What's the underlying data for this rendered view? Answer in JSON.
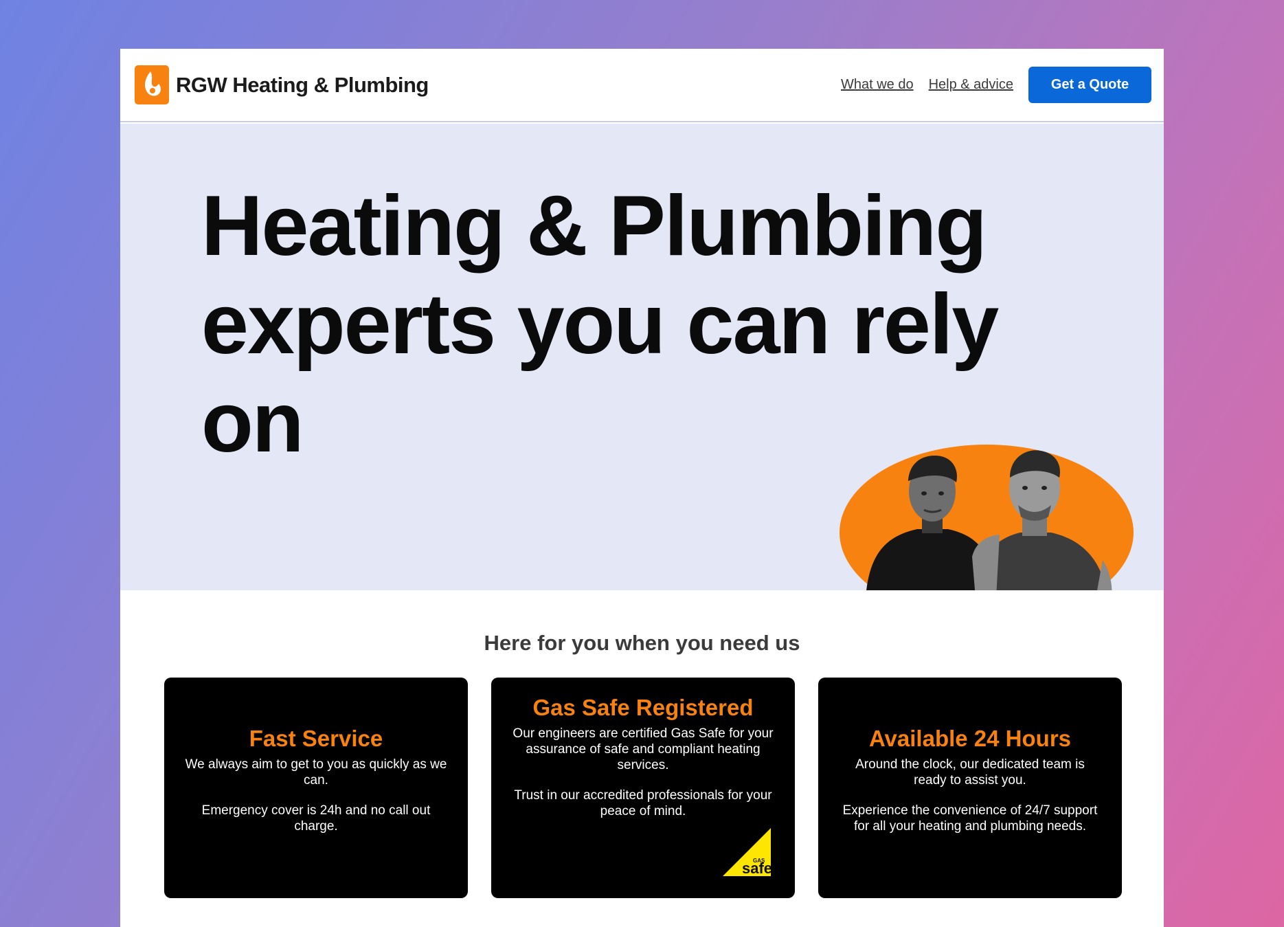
{
  "header": {
    "logo_text": "RGW Heating & Plumbing",
    "nav": [
      {
        "label": "What we do"
      },
      {
        "label": "Help & advice"
      }
    ],
    "cta_label": "Get a Quote"
  },
  "hero": {
    "title": "Heating & Plumbing experts you can rely on"
  },
  "section": {
    "title": "Here for you when you need us",
    "cards": [
      {
        "title": "Fast Service",
        "paragraphs": [
          "We always aim to get to you as quickly as we can.",
          "Emergency cover is 24h and no call out charge."
        ]
      },
      {
        "title": "Gas Safe Registered",
        "paragraphs": [
          "Our engineers are certified Gas Safe for your assurance of safe and compliant heating services.",
          "Trust in our accredited professionals for your peace of mind."
        ],
        "badge": {
          "top": "GAS",
          "bottom": "safe"
        }
      },
      {
        "title": "Available 24 Hours",
        "paragraphs": [
          "Around the clock, our dedicated team is ready to assist you.",
          "Experience the convenience of 24/7 support for all your heating and plumbing needs."
        ]
      }
    ]
  },
  "colors": {
    "accent": "#f7820f",
    "cta": "#0a68d8",
    "hero_bg": "#e3e7f6",
    "card_bg": "#000000"
  }
}
